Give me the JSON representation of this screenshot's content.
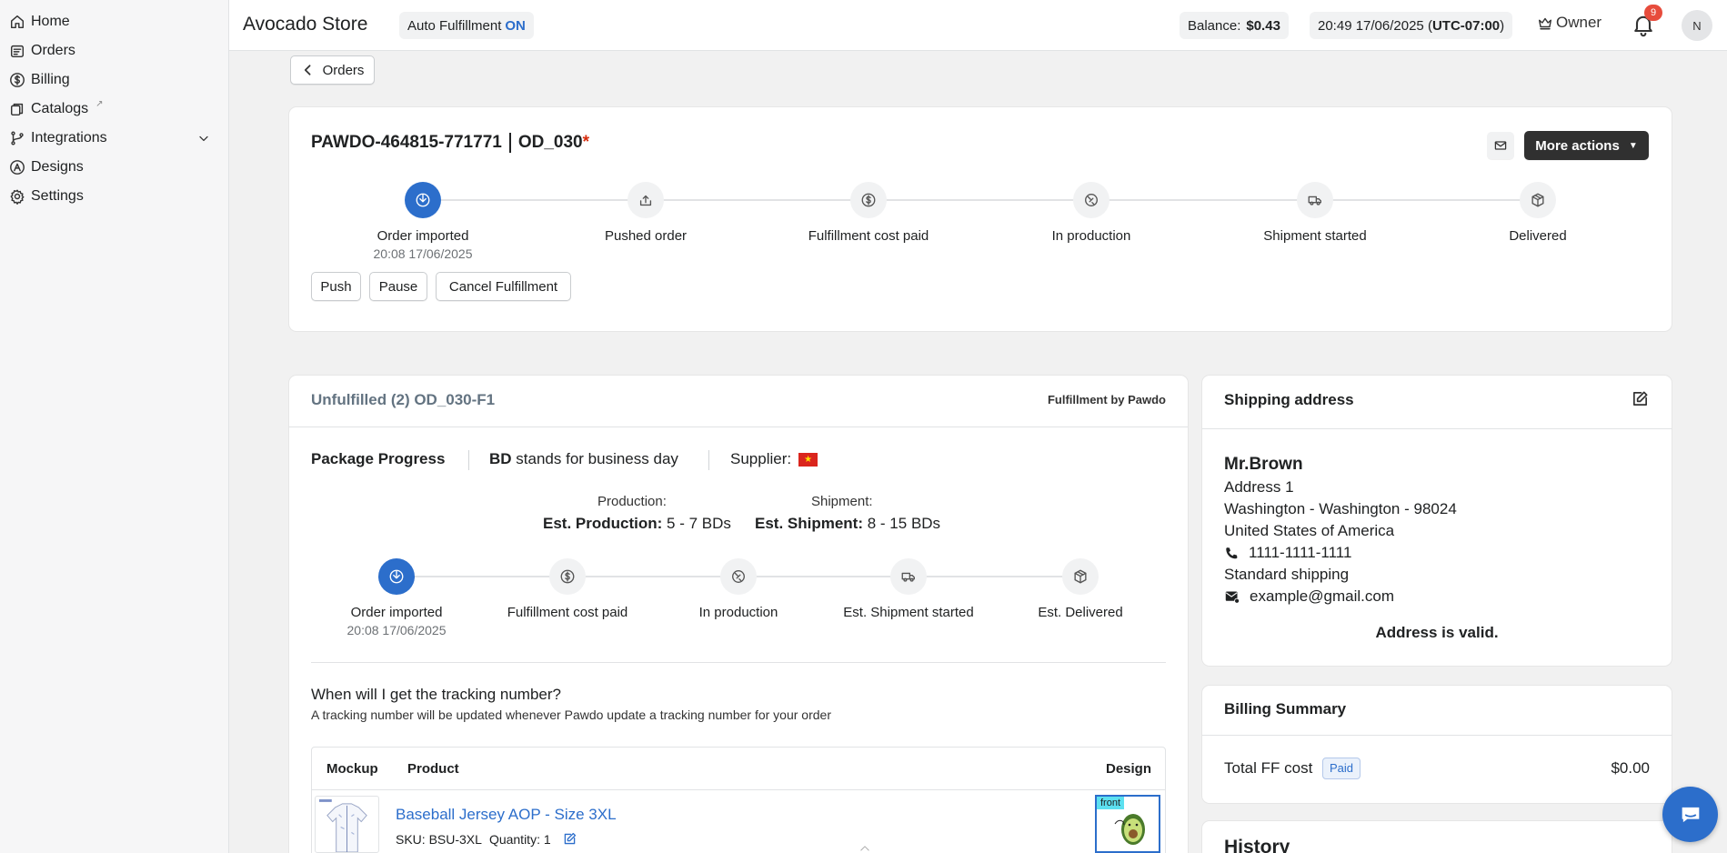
{
  "sidebar": {
    "items": [
      {
        "label": "Home",
        "icon": "home-icon"
      },
      {
        "label": "Orders",
        "icon": "orders-icon"
      },
      {
        "label": "Billing",
        "icon": "billing-icon"
      },
      {
        "label": "Catalogs",
        "icon": "catalogs-icon"
      },
      {
        "label": "Integrations",
        "icon": "integrations-icon"
      },
      {
        "label": "Designs",
        "icon": "designs-icon"
      },
      {
        "label": "Settings",
        "icon": "gear-icon"
      }
    ]
  },
  "topbar": {
    "store_name": "Avocado Store",
    "auto_fulfillment_label": "Auto Fulfillment",
    "auto_fulfillment_state": "ON",
    "balance_label": "Balance:",
    "balance_value": "$0.43",
    "datetime": "20:49 17/06/2025 (",
    "timezone": "UTC-07:00",
    "datetime_close": ")",
    "role": "Owner",
    "notification_count": "9",
    "avatar_initial": "N"
  },
  "back_button": {
    "label": "Orders"
  },
  "order": {
    "id": "PAWDO-464815-771771",
    "name": "OD_030",
    "required_mark": "*",
    "more_actions_label": "More actions",
    "steps": [
      {
        "label": "Order imported",
        "date": "20:08 17/06/2025",
        "icon": "download-icon"
      },
      {
        "label": "Pushed order",
        "date": "",
        "icon": "upload-icon"
      },
      {
        "label": "Fulfillment cost paid",
        "date": "",
        "icon": "dollar-icon"
      },
      {
        "label": "In production",
        "date": "",
        "icon": "production-icon"
      },
      {
        "label": "Shipment started",
        "date": "",
        "icon": "truck-icon"
      },
      {
        "label": "Delivered",
        "date": "",
        "icon": "box-icon"
      }
    ],
    "actions": {
      "push": "Push",
      "pause": "Pause",
      "cancel": "Cancel Fulfillment"
    }
  },
  "fulfillment": {
    "title": "Unfulfilled (2) OD_030-F1",
    "fulfilled_by": "Fulfillment by Pawdo",
    "package_progress": "Package Progress",
    "bd_abbr": "BD",
    "bd_text": "stands for business day",
    "supplier_label": "Supplier:",
    "supplier_flag_color": "#da251d",
    "production_label": "Production:",
    "est_production_label": "Est. Production:",
    "est_production_value": "5 - 7 BDs",
    "shipment_label": "Shipment:",
    "est_shipment_label": "Est. Shipment:",
    "est_shipment_value": "8 - 15 BDs",
    "steps": [
      {
        "label": "Order imported",
        "date": "20:08 17/06/2025",
        "icon": "download-icon"
      },
      {
        "label": "Fulfillment cost paid",
        "date": "",
        "icon": "dollar-icon"
      },
      {
        "label": "In production",
        "date": "",
        "icon": "production-icon"
      },
      {
        "label": "Est. Shipment started",
        "date": "",
        "icon": "truck-icon"
      },
      {
        "label": "Est. Delivered",
        "date": "",
        "icon": "box-icon"
      }
    ],
    "tracking_question": "When will I get the tracking number?",
    "tracking_answer": "A tracking number will be updated whenever Pawdo update a tracking number for your order",
    "table": {
      "headers": {
        "mockup": "Mockup",
        "product": "Product",
        "design": "Design"
      },
      "rows": [
        {
          "product": "Baseball Jersey AOP - Size 3XL",
          "sku": "SKU: BSU-3XL",
          "quantity": "Quantity: 1",
          "design_side": "front"
        }
      ]
    }
  },
  "shipping": {
    "title": "Shipping address",
    "name": "Mr.Brown",
    "address1": "Address 1",
    "city_line": "Washington - Washington - 98024",
    "country": "United States of America",
    "phone": "1111-1111-1111",
    "method": "Standard shipping",
    "email": "example@gmail.com",
    "validity": "Address is valid."
  },
  "billing": {
    "title": "Billing Summary",
    "total_label": "Total FF cost",
    "status": "Paid",
    "amount": "$0.00"
  },
  "history": {
    "title": "History"
  },
  "colors": {
    "accent": "#2c6ecb",
    "dark_button": "#303030"
  }
}
